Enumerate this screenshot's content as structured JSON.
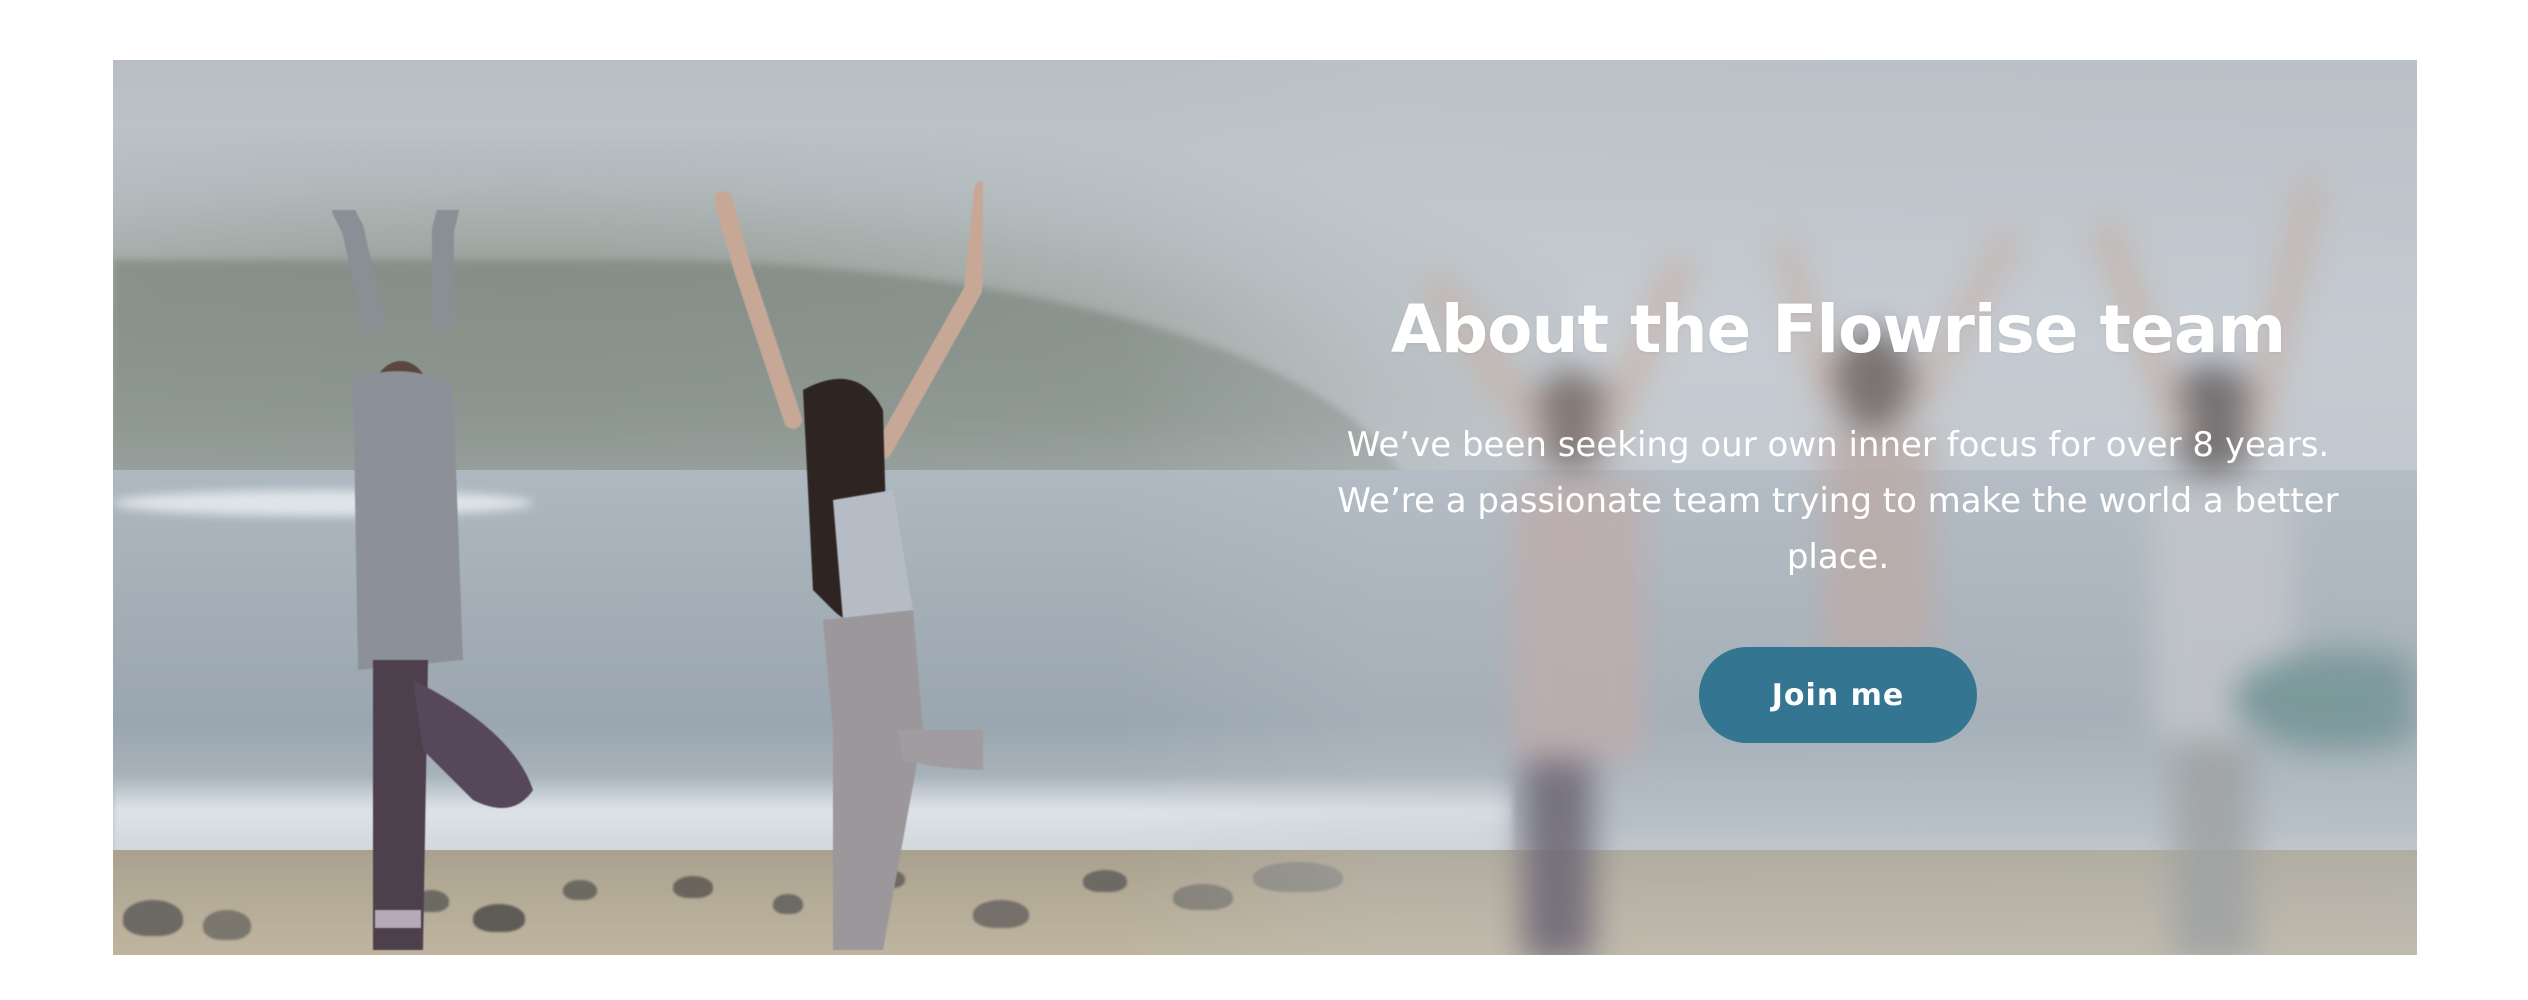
{
  "hero": {
    "title": "About the Flowrise team",
    "description": "We’ve been seeking our own inner focus for over 8 years. We’re a passionate team trying to make the world a better place.",
    "cta_label": "Join me"
  },
  "colors": {
    "button": "#347591",
    "text": "#ffffff",
    "page_background": "#ffffff"
  }
}
